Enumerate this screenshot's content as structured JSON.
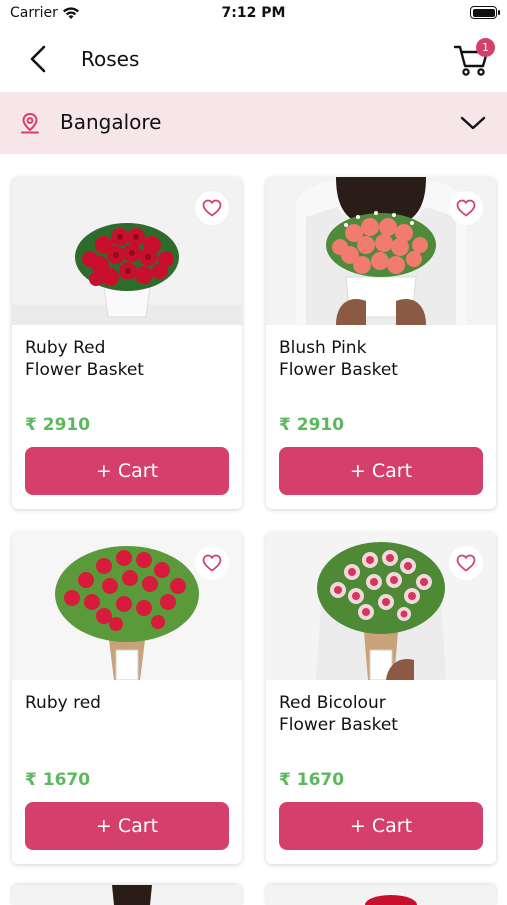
{
  "status_bar": {
    "carrier": "Carrier",
    "time": "7:12 PM"
  },
  "nav": {
    "title": "Roses",
    "cart_count": "1"
  },
  "location": {
    "city": "Bangalore"
  },
  "products": [
    {
      "name_line1": "Ruby Red",
      "name_line2": "Flower Basket",
      "price": "₹ 2910",
      "cart_label": "+ Cart",
      "image": "red-roses-basket"
    },
    {
      "name_line1": "Blush Pink",
      "name_line2": "Flower Basket",
      "price": "₹ 2910",
      "cart_label": "+ Cart",
      "image": "pink-roses-basket"
    },
    {
      "name_line1": "Ruby red",
      "name_line2": "",
      "price": "₹ 1670",
      "cart_label": "+ Cart",
      "image": "red-roses-bouquet"
    },
    {
      "name_line1": "Red Bicolour",
      "name_line2": "Flower Basket",
      "price": "₹ 1670",
      "cart_label": "+ Cart",
      "image": "bicolour-roses-bouquet"
    }
  ],
  "colors": {
    "accent": "#d4406b",
    "price": "#5cb85c",
    "location_bg": "#f6e6ea"
  }
}
